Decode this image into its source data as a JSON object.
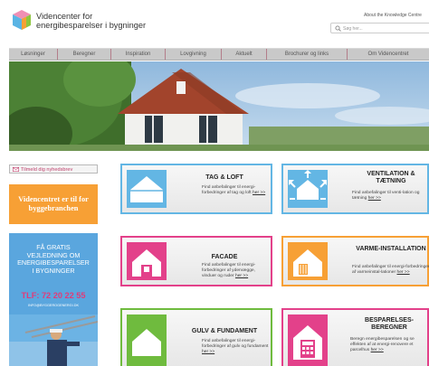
{
  "header": {
    "logo_line1": "Videncenter for",
    "logo_line2": "energibesparelser i bygninger",
    "top_link": "About the Knowledge Centre",
    "search_placeholder": "Søg her..."
  },
  "nav": {
    "items": [
      "Løsninger",
      "Beregner",
      "Inspiration",
      "Lovgivning",
      "Aktuelt",
      "Brochurer og links",
      "Om Videncentret"
    ]
  },
  "sidebar": {
    "newsletter_label": "Tilmeld dig nyhedsbrev",
    "orange_box": "Videncentret er til for byggebranchen",
    "blue_box": {
      "line1": "FÅ GRATIS",
      "line2": "VEJLEDNING OM",
      "line3": "ENERGIBESPARELSER",
      "line4": "I BYGNINGER",
      "phone": "TLF: 72 20 22 55",
      "email": "INFO@BYGGEROGENERGI.DK"
    }
  },
  "tiles": [
    {
      "title": "TAG & LOFT",
      "desc": "Find anbefalinger til energi-forbedringer af tag og loft",
      "link": "her >>",
      "color": "#63b6e4"
    },
    {
      "title": "VENTILATION & TÆTNING",
      "desc": "Find anbefalinger til venti-lation og tætning",
      "link": "her >>",
      "color": "#63b6e4"
    },
    {
      "title": "FACADE",
      "desc": "Find anbefalinger til energi-forbedringer af ydervægge, vinduer og ruder",
      "link": "her >>",
      "color": "#e3418a"
    },
    {
      "title": "VARME-INSTALLATION",
      "desc": "Find anbefalinger til energi-forbedringer af varmeinstal-lationer",
      "link": "her >>",
      "color": "#f7a035"
    },
    {
      "title": "GULV & FUNDAMENT",
      "desc": "Find anbefalinger til energi-forbedringer af gulv og fundament",
      "link": "her >>",
      "color": "#6fbb3e"
    },
    {
      "title": "BESPARELSES-BEREGNER",
      "desc": "Beregn energibesparelsen og se effekten af at energi-renovere et parcelhus",
      "link": "her >>",
      "color": "#e3418a"
    }
  ]
}
